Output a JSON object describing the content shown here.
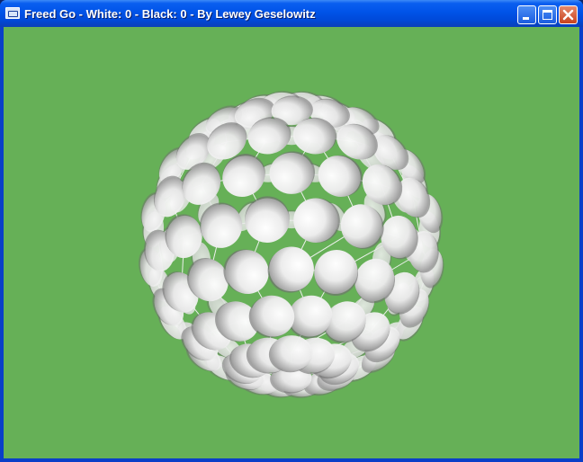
{
  "window": {
    "title": "Freed Go - White: 0 - Black: 0 - By Lewey Geselowitz",
    "icon": "app-window-icon",
    "controls": [
      "minimize",
      "maximize",
      "close"
    ]
  },
  "colors": {
    "titlebar": "#0053e8",
    "background": "#66b057",
    "stones": "#f2f2f2"
  }
}
